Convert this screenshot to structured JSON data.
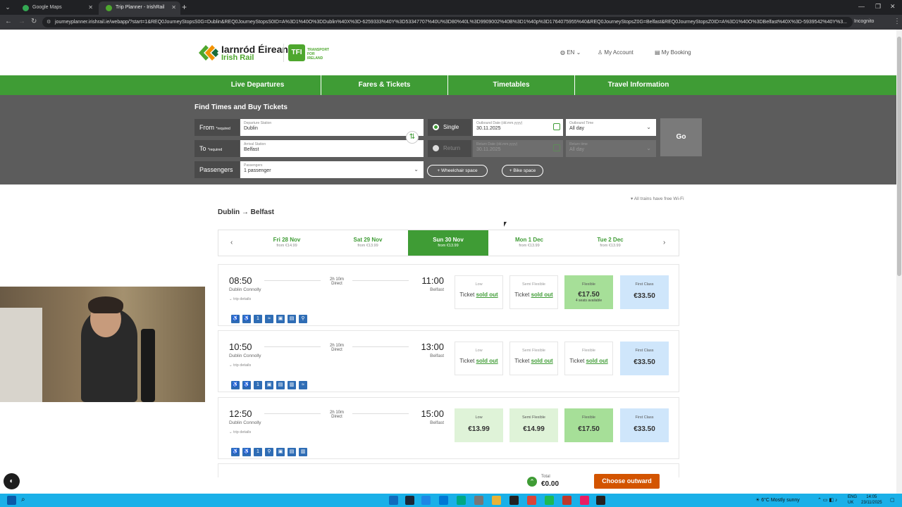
{
  "browser": {
    "tabs": [
      {
        "title": "Google Maps",
        "active": false
      },
      {
        "title": "Trip Planner - IrishRail",
        "active": true
      }
    ],
    "url": "journeyplanner.irishrail.ie/webapp/?start=1&REQ0JourneyStopsS0G=Dublin&REQ0JourneyStopsS0ID=A%3D1%40O%3DDublin%40X%3D-6259333%40Y%3D53347707%40U%3D80%40L%3D9909002%40B%3D1%40p%3D1764075955%40&REQ0JourneyStopsZ0G=Belfast&REQ0JourneyStopsZ0ID=A%3D1%40O%3DBelfast%40X%3D-5939542%40Y%3...",
    "mode": "Incognito"
  },
  "header": {
    "logo_line1": "Iarnród Éireann",
    "logo_line2": "Irish Rail",
    "tfi_badge": "TFI",
    "tfi_text": "TRANSPORT FOR IRELAND",
    "language": "EN",
    "my_account": "My Account",
    "my_booking": "My Booking"
  },
  "nav": [
    "Live Departures",
    "Fares & Tickets",
    "Timetables",
    "Travel Information"
  ],
  "search": {
    "title": "Find Times and Buy Tickets",
    "from_label": "From",
    "to_label": "To",
    "required": "*required",
    "departure_caption": "Departure Station",
    "departure_value": "Dublin",
    "arrival_caption": "Arrival Station",
    "arrival_value": "Belfast",
    "passengers_label": "Passengers",
    "passengers_caption": "Passengers",
    "passengers_value": "1 passenger",
    "single_label": "Single",
    "return_label": "Return",
    "outbound_date_caption": "Outbound Date (dd.mm.yyyy)",
    "outbound_date": "30.11.2025",
    "outbound_time_caption": "Outbound Time",
    "outbound_time": "All day",
    "return_date_caption": "Return Date (dd.mm.yyyy)",
    "return_date": "30.11.2025",
    "return_time_caption": "Return time",
    "return_time": "All day",
    "go": "Go",
    "wheelchair": "+ Wheelchair space",
    "bike": "+ Bike space"
  },
  "results": {
    "wifi_note": "All trains have free Wi-Fi",
    "route": "Dublin → Belfast",
    "dates": [
      {
        "day": "Fri 28 Nov",
        "from": "from €14.99",
        "active": false
      },
      {
        "day": "Sat 29 Nov",
        "from": "from €13.99",
        "active": false
      },
      {
        "day": "Sun 30 Nov",
        "from": "from €13.99",
        "active": true
      },
      {
        "day": "Mon 1 Dec",
        "from": "from €13.99",
        "active": false
      },
      {
        "day": "Tue 2 Dec",
        "from": "from €13.99",
        "active": false
      }
    ],
    "journeys": [
      {
        "dep": "08:50",
        "dep_station": "Dublin Connolly",
        "duration": "2h 10m",
        "type": "Direct",
        "arr": "11:00",
        "arr_station": "Belfast",
        "trip_details": "trip details",
        "fares": [
          {
            "name": "Low",
            "ticket": "Ticket",
            "status": "sold out",
            "price": "",
            "extra": ""
          },
          {
            "name": "Semi Flexible",
            "ticket": "Ticket",
            "status": "sold out",
            "price": "",
            "extra": ""
          },
          {
            "name": "Flexible",
            "ticket": "",
            "status": "",
            "price": "€17.50",
            "extra": "4 seats available"
          },
          {
            "name": "First Class",
            "ticket": "",
            "status": "",
            "price": "€33.50",
            "extra": ""
          }
        ]
      },
      {
        "dep": "10:50",
        "dep_station": "Dublin Connolly",
        "duration": "2h 10m",
        "type": "Direct",
        "arr": "13:00",
        "arr_station": "Belfast",
        "trip_details": "trip details",
        "fares": [
          {
            "name": "Low",
            "ticket": "Ticket",
            "status": "sold out",
            "price": "",
            "extra": ""
          },
          {
            "name": "Semi Flexible",
            "ticket": "Ticket",
            "status": "sold out",
            "price": "",
            "extra": ""
          },
          {
            "name": "Flexible",
            "ticket": "Ticket",
            "status": "sold out",
            "price": "",
            "extra": ""
          },
          {
            "name": "First Class",
            "ticket": "",
            "status": "",
            "price": "€33.50",
            "extra": ""
          }
        ]
      },
      {
        "dep": "12:50",
        "dep_station": "Dublin Connolly",
        "duration": "2h 10m",
        "type": "Direct",
        "arr": "15:00",
        "arr_station": "Belfast",
        "trip_details": "trip details",
        "fares": [
          {
            "name": "Low",
            "ticket": "",
            "status": "",
            "price": "€13.99",
            "extra": ""
          },
          {
            "name": "Semi Flexible",
            "ticket": "",
            "status": "",
            "price": "€14.99",
            "extra": ""
          },
          {
            "name": "Flexible",
            "ticket": "",
            "status": "",
            "price": "€17.50",
            "extra": ""
          },
          {
            "name": "First Class",
            "ticket": "",
            "status": "",
            "price": "€33.50",
            "extra": ""
          }
        ]
      }
    ]
  },
  "footer": {
    "total_label": "Total",
    "total_value": "€0.00",
    "choose": "Choose outward"
  },
  "taskbar": {
    "weather": "6°C Mostly sunny",
    "lang": "ENG",
    "region": "UK",
    "time": "14:05",
    "date": "23/11/2025"
  }
}
